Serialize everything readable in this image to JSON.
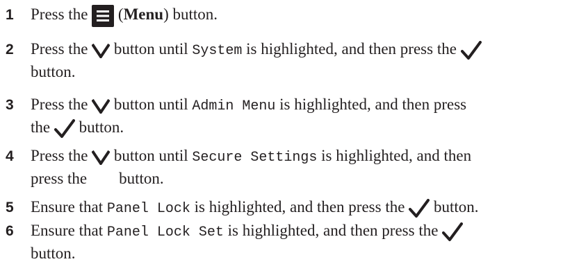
{
  "steps": [
    {
      "number": "1",
      "t1": "Press the ",
      "icon": "menu-icon",
      "t2": " (",
      "bold": "Menu",
      "t3": ") button."
    },
    {
      "number": "2",
      "t1": "Press the ",
      "icon": "chevron-down-icon",
      "t2": " button until ",
      "code": "System",
      "t3": " is highlighted, and then press the ",
      "icon2": "checkmark-icon",
      "t4": "button."
    },
    {
      "number": "3",
      "t1": "Press the ",
      "icon": "chevron-down-icon",
      "t2": " button until ",
      "code": "Admin Menu",
      "t3": " is highlighted, and then press",
      "t4": "the ",
      "icon2": "checkmark-icon",
      "t5": " button."
    },
    {
      "number": "4",
      "t1": "Press the ",
      "icon": "chevron-down-icon",
      "t2": " button until ",
      "code": "Secure Settings",
      "t3": " is highlighted, and then",
      "t4": "press the        button."
    },
    {
      "number": "5",
      "t1": "Ensure that ",
      "code": "Panel Lock",
      "t2": " is highlighted, and then press the ",
      "icon": "checkmark-icon",
      "t3": " button."
    },
    {
      "number": "6",
      "t1": "Ensure that ",
      "code": "Panel Lock Set",
      "t2": " is highlighted, and then press the ",
      "icon": "checkmark-icon",
      "t3": "button."
    }
  ]
}
